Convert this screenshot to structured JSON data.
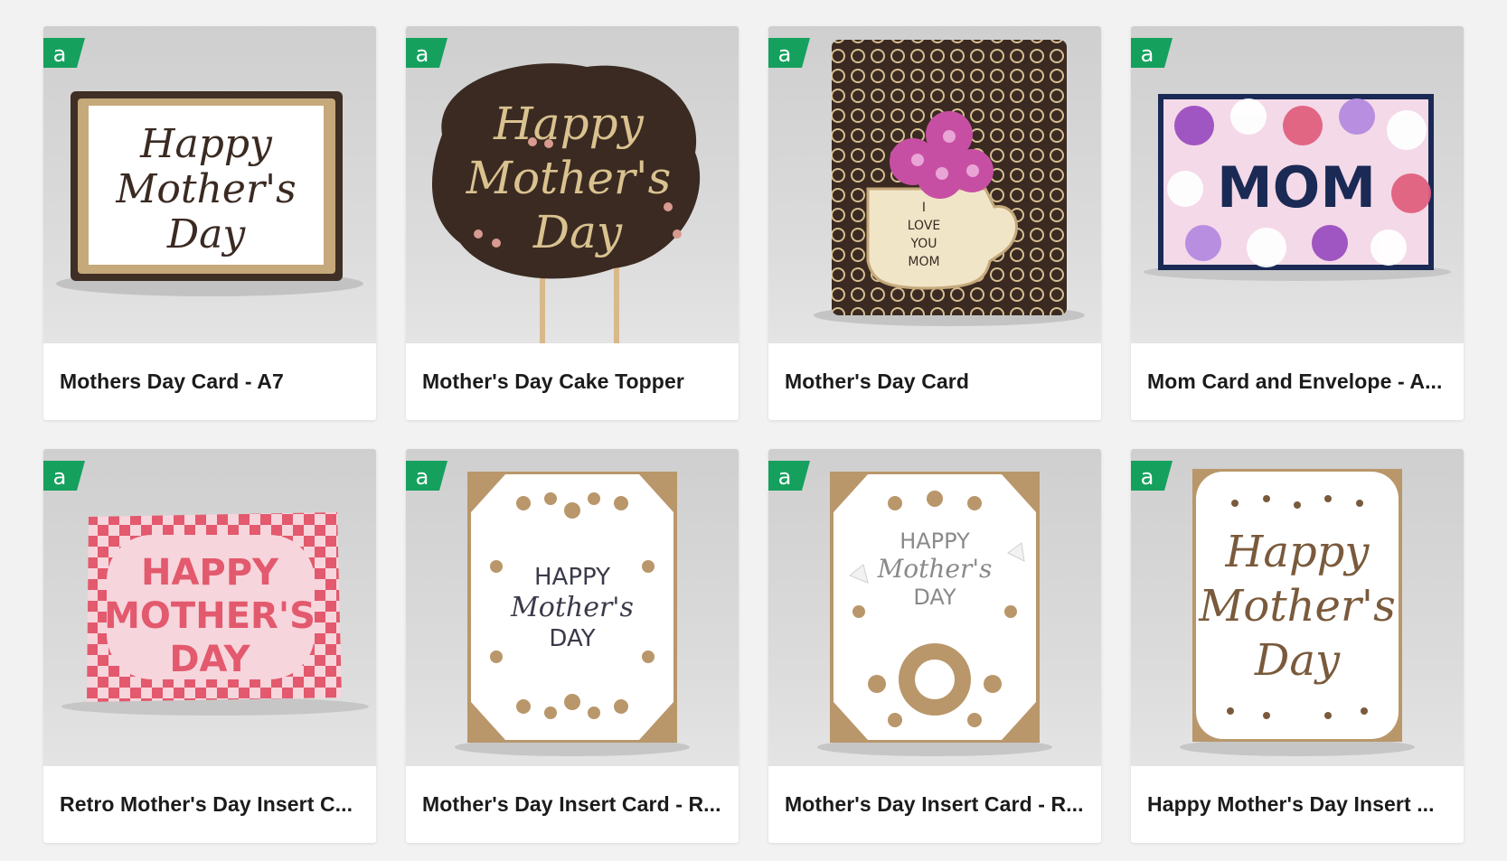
{
  "badge": {
    "icon": "access-badge-icon",
    "glyph": "a",
    "color": "#15a05e"
  },
  "cards": [
    {
      "title": "Mothers Day Card - A7"
    },
    {
      "title": "Mother's Day Cake Topper"
    },
    {
      "title": "Mother's Day Card"
    },
    {
      "title": "Mom Card and Envelope - A..."
    },
    {
      "title": "Retro Mother's Day Insert C..."
    },
    {
      "title": "Mother's Day Insert Card - R..."
    },
    {
      "title": "Mother's Day Insert Card - R..."
    },
    {
      "title": "Happy Mother's Day Insert ..."
    }
  ],
  "thumbs": {
    "card1": {
      "line1": "Happy",
      "line2": "Mother's",
      "line3": "Day"
    },
    "card2": {
      "line1": "Happy",
      "line2": "Mother's",
      "line3": "Day"
    },
    "card3": {
      "line1": "I",
      "line2": "LOVE",
      "line3": "YOU",
      "line4": "MOM"
    },
    "card4": {
      "word": "MOM"
    },
    "card5": {
      "line1": "HAPPY",
      "line2": "MOTHER'S",
      "line3": "DAY"
    },
    "card6": {
      "line1": "HAPPY",
      "line2": "Mother's",
      "line3": "DAY"
    },
    "card7": {
      "line1": "HAPPY",
      "line2": "Mother's",
      "line3": "DAY"
    },
    "card8": {
      "line1": "Happy",
      "line2": "Mother's",
      "line3": "Day"
    }
  }
}
